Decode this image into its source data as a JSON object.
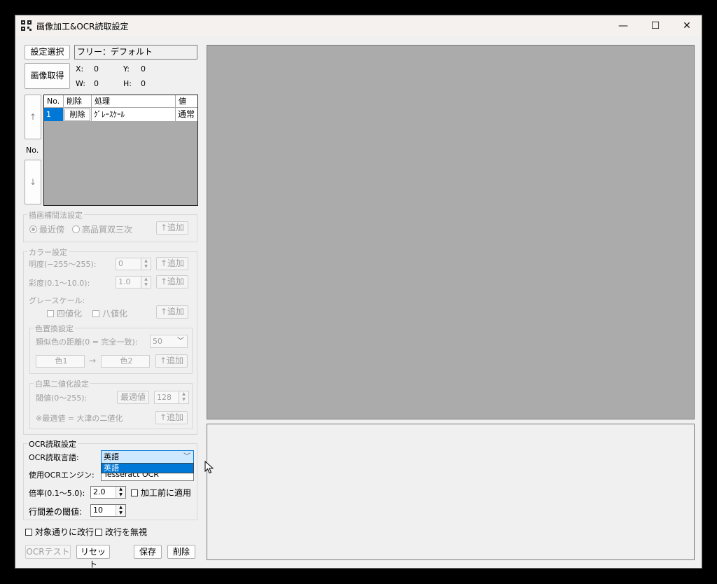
{
  "window": {
    "title": "画像加工&OCR読取設定",
    "min": "—",
    "max": "☐",
    "close": "✕"
  },
  "setting": {
    "select_button": "設定選択",
    "name": "フリー：デフォルト"
  },
  "capture": {
    "button": "画像取得",
    "x_label": "X:",
    "x_value": "0",
    "y_label": "Y:",
    "y_value": "0",
    "w_label": "W:",
    "w_value": "0",
    "h_label": "H:",
    "h_value": "0"
  },
  "order": {
    "up": "↑",
    "label": "No.",
    "down": "↓"
  },
  "grid": {
    "headers": [
      "No.",
      "削除",
      "処理",
      "値"
    ],
    "rows": [
      {
        "no": "1",
        "delete": "削除",
        "process": "ｸﾞﾚｰｽｹｰﾙ",
        "value": "通常"
      }
    ]
  },
  "interp": {
    "title": "描画補間法設定",
    "option1": "最近傍",
    "option2": "高品質双三次",
    "add": "↑追加"
  },
  "color": {
    "title": "カラー設定",
    "brightness_label": "明度(−255〜255):",
    "brightness_value": "0",
    "saturation_label": "彩度(0.1〜10.0):",
    "saturation_value": "1.0",
    "gray_label": "グレースケール:",
    "gray_opt1": "四値化",
    "gray_opt2": "八値化",
    "add": "↑追加"
  },
  "replace": {
    "title": "色置換設定",
    "distance_label": "類似色の距離(0 = 完全一致):",
    "distance_value": "50",
    "color1": "色1",
    "arrow": "→",
    "color2": "色2",
    "add": "↑追加"
  },
  "binarize": {
    "title": "白黒二値化設定",
    "threshold_label": "閾値(0〜255):",
    "optimal_button": "最適値",
    "threshold_value": "128",
    "note": "※最適値 = 大津の二値化",
    "add": "↑追加"
  },
  "ocr": {
    "title": "OCR読取設定",
    "lang_label": "OCR読取言語:",
    "lang_value": "英語",
    "lang_option": "英語",
    "engine_label": "使用OCRエンジン:",
    "engine_value": "Tesseract OCR",
    "scale_label": "倍率(0.1〜5.0):",
    "scale_value": "2.0",
    "apply_before": "加工前に適用",
    "line_gap_label": "行間差の閾値:",
    "line_gap_value": "10"
  },
  "options": {
    "newline_target": "対象通りに改行",
    "ignore_newline": "改行を無視"
  },
  "buttons": {
    "ocr_test": "OCRテスト",
    "reset": "リセット",
    "save": "保存",
    "delete": "削除"
  },
  "colors": {
    "preview_bg": "#ababab",
    "selection": "#0078d7",
    "window_bg": "#f0f0f0"
  }
}
